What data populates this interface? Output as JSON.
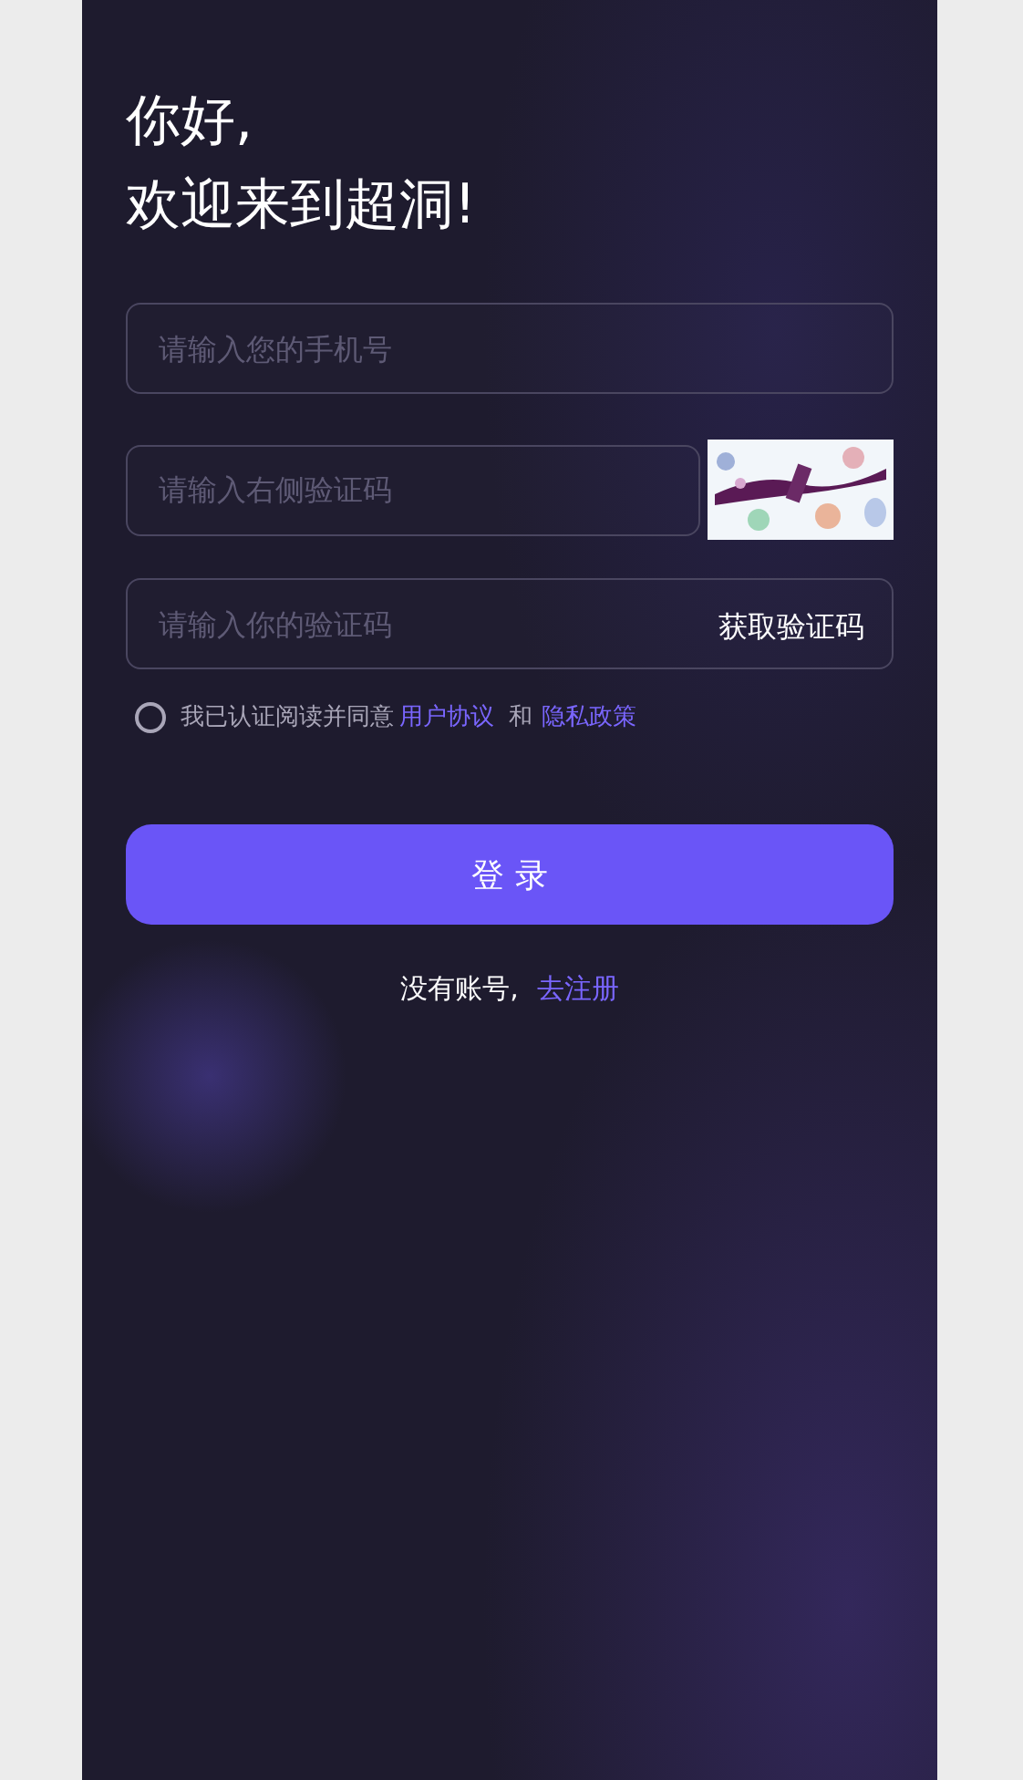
{
  "greeting": {
    "lines": [
      "你好,",
      "欢迎来到超洞!"
    ]
  },
  "phone_field": {
    "placeholder": "请输入您的手机号"
  },
  "captcha_field": {
    "placeholder": "请输入右侧验证码"
  },
  "sms_field": {
    "placeholder": "请输入你的验证码",
    "action": "获取验证码"
  },
  "agreement": {
    "checked": false,
    "text": "我已认证阅读并同意",
    "links": [
      "用户协议",
      "隐私政策"
    ],
    "joiner": "和"
  },
  "login_button": "登 录",
  "register": {
    "text": "没有账号,",
    "link": "去注册"
  }
}
